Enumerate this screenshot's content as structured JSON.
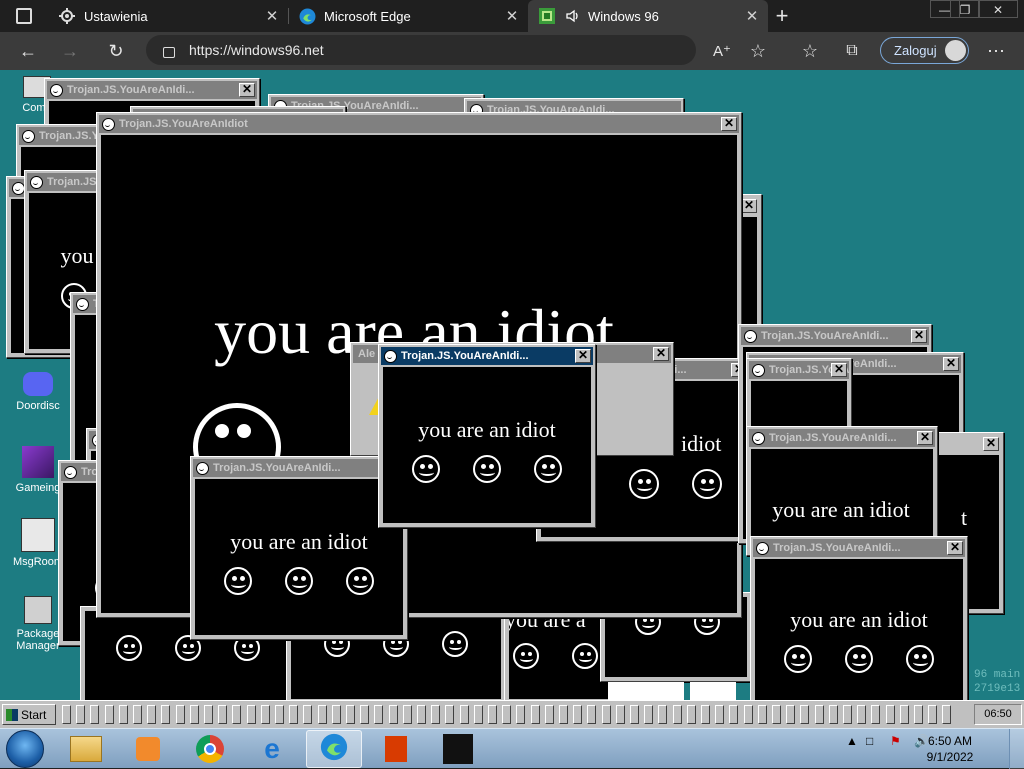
{
  "browser": {
    "tabs": [
      {
        "label": "Ustawienia",
        "icon": "gear-icon"
      },
      {
        "label": "Microsoft Edge",
        "icon": "edge-icon"
      },
      {
        "label": "Windows 96",
        "icon": "windows96-icon",
        "active": true
      }
    ],
    "new_tab": "+",
    "close_tab": "✕",
    "url": "https://windows96.net",
    "signin_label": "Zaloguj",
    "window_controls": [
      "—",
      "❐",
      "✕"
    ]
  },
  "desktop_icons": [
    {
      "label": "Comp",
      "icon": "computer-icon"
    },
    {
      "label": "Doordisc",
      "icon": "discord-icon"
    },
    {
      "label": "Gameing",
      "icon": "game-cube-icon"
    },
    {
      "label": "MsgRoom",
      "icon": "msgroom-icon"
    },
    {
      "label": "Package Manager",
      "icon": "package-manager-icon"
    }
  ],
  "popup": {
    "title": "Trojan.JS.YouAreAnIdiot",
    "title_short": "Trojan.JS.YouAreAnIdi...",
    "message": "you are an idiot",
    "alert_title": "Ale"
  },
  "partial_texts": {
    "you": "you",
    "yo": "yo",
    "idiot": "idiot",
    "you_are_a": "you are a",
    "t": "t"
  },
  "background_text": {
    "line1": "96 main",
    "line2": "2719e13"
  },
  "w96_taskbar": {
    "start_label": "Start",
    "clock": "06:50",
    "window_slot_count": 63
  },
  "win7_taskbar": {
    "apps": [
      "file-explorer-icon",
      "media-player-icon",
      "chrome-icon",
      "internet-explorer-icon",
      "edge-icon",
      "office-icon",
      "app-icon"
    ],
    "time": "6:50 AM",
    "date": "9/1/2022"
  }
}
